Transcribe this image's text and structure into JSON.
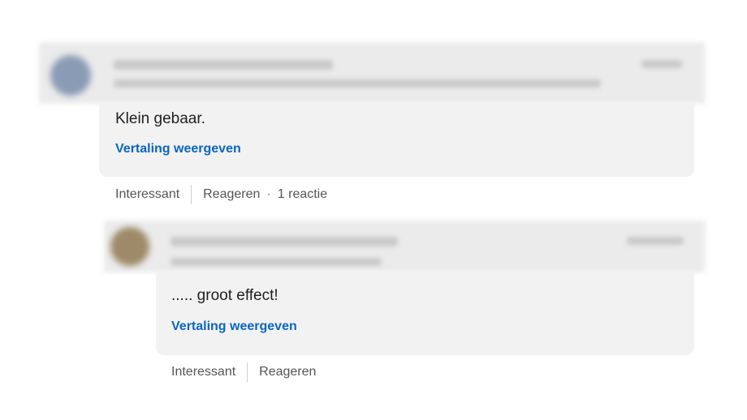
{
  "comments": [
    {
      "text": "Klein gebaar.",
      "translate_label": "Vertaling weergeven",
      "like_label": "Interessant",
      "reply_label": "Reageren",
      "reply_count": "1 reactie"
    },
    {
      "text": "..... groot effect!",
      "translate_label": "Vertaling weergeven",
      "like_label": "Interessant",
      "reply_label": "Reageren"
    }
  ],
  "colors": {
    "link": "#0a66c2",
    "bubble": "#f2f2f2",
    "text": "#1f1f1f",
    "muted": "#555555"
  },
  "icons": {
    "avatar_1": "avatar",
    "avatar_2": "avatar"
  }
}
